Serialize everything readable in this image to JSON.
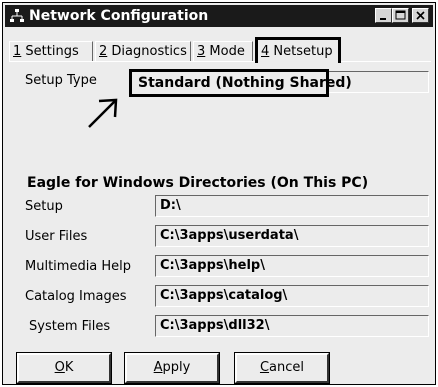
{
  "window": {
    "title": "Network Configuration"
  },
  "tabs": [
    {
      "num": "1",
      "label": " Settings"
    },
    {
      "num": "2",
      "label": " Diagnostics"
    },
    {
      "num": "3",
      "label": " Mode"
    },
    {
      "num": "4",
      "label": " Netsetup"
    }
  ],
  "setup_type": {
    "label": "Setup Type",
    "value": "Standard (Nothing Shared)"
  },
  "directories": {
    "heading": "Eagle for Windows Directories (On This PC)",
    "rows": [
      {
        "label": "Setup",
        "value": "D:\\"
      },
      {
        "label": "User Files",
        "value": "C:\\3apps\\userdata\\"
      },
      {
        "label": "Multimedia Help",
        "value": "C:\\3apps\\help\\"
      },
      {
        "label": "Catalog Images",
        "value": "C:\\3apps\\catalog\\"
      },
      {
        "label": "System Files",
        "value": "C:\\3apps\\dll32\\"
      }
    ]
  },
  "buttons": {
    "ok": {
      "mnemonic": "O",
      "rest": "K"
    },
    "apply": {
      "mnemonic": "A",
      "rest": "pply"
    },
    "cancel": {
      "mnemonic": "C",
      "rest": "ancel"
    }
  },
  "icons": {
    "app": "network-icon",
    "minimize": "minimize-icon",
    "maximize": "maximize-icon",
    "close": "close-icon",
    "annotation": "arrow-icon"
  },
  "colors": {
    "titlebar": "#1a1a1a",
    "face": "#ececec"
  }
}
